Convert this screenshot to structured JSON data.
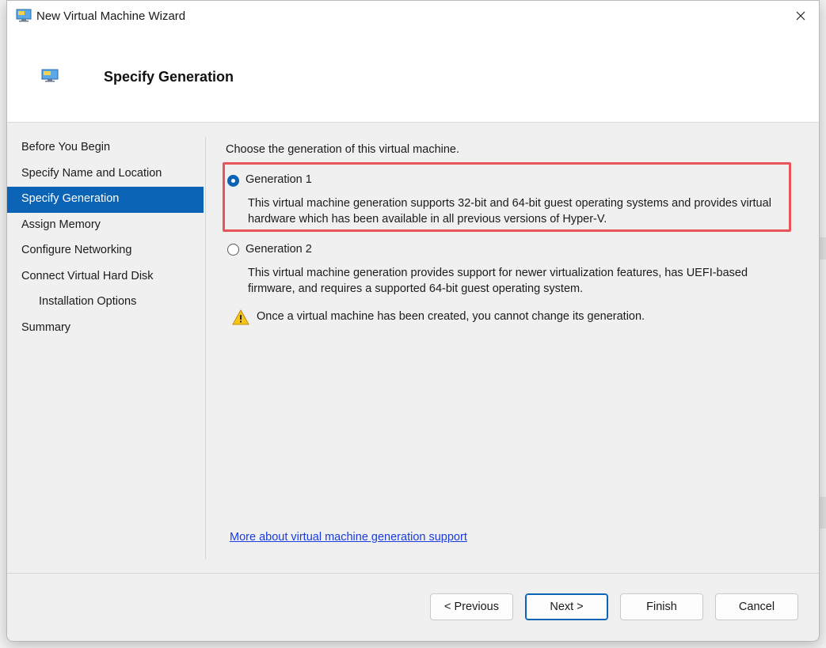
{
  "window": {
    "title": "New Virtual Machine Wizard",
    "header_title": "Specify Generation"
  },
  "nav": {
    "items": [
      {
        "label": "Before You Begin",
        "active": false,
        "indent": false
      },
      {
        "label": "Specify Name and Location",
        "active": false,
        "indent": false
      },
      {
        "label": "Specify Generation",
        "active": true,
        "indent": false
      },
      {
        "label": "Assign Memory",
        "active": false,
        "indent": false
      },
      {
        "label": "Configure Networking",
        "active": false,
        "indent": false
      },
      {
        "label": "Connect Virtual Hard Disk",
        "active": false,
        "indent": false
      },
      {
        "label": "Installation Options",
        "active": false,
        "indent": true
      },
      {
        "label": "Summary",
        "active": false,
        "indent": false
      }
    ]
  },
  "content": {
    "intro": "Choose the generation of this virtual machine.",
    "gen1": {
      "label": "Generation 1",
      "checked": true,
      "desc_line1": "This virtual machine generation supports 32-bit and 64-bit guest operating systems and provides virtual",
      "desc_line2": "hardware which has been available in all previous versions of Hyper-V."
    },
    "gen2": {
      "label": "Generation 2",
      "checked": false,
      "desc_line1": "This virtual machine generation provides support for newer virtualization features, has UEFI-based",
      "desc_line2": "firmware, and requires a supported 64-bit guest operating system."
    },
    "warning": "Once a virtual machine has been created, you cannot change its generation.",
    "more_link": "More about virtual machine generation support"
  },
  "buttons": {
    "previous": "< Previous",
    "next": "Next >",
    "finish": "Finish",
    "cancel": "Cancel"
  },
  "colors": {
    "accent": "#0b63b6",
    "highlight": "#e8545a",
    "link": "#1a3be0"
  }
}
